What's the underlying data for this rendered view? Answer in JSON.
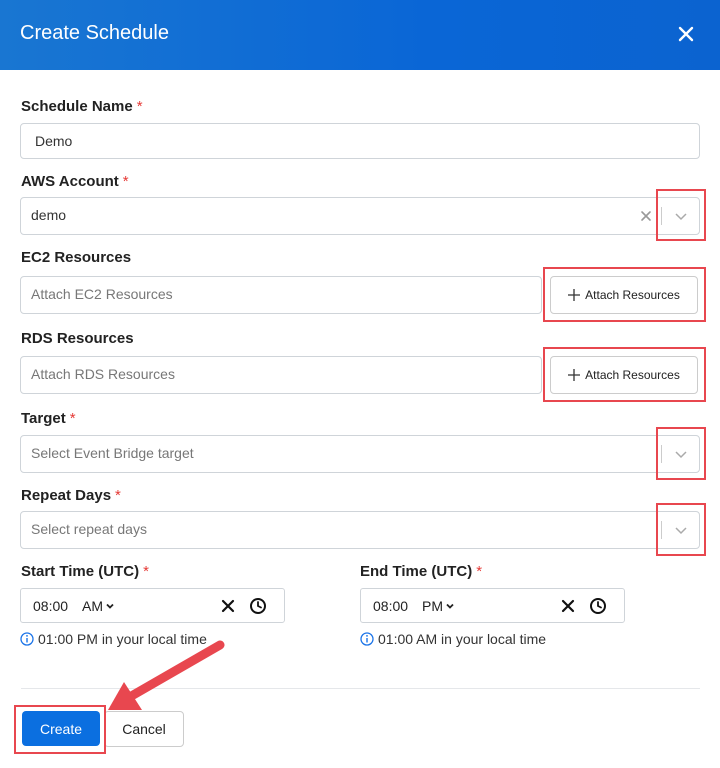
{
  "dialog": {
    "title": "Create Schedule"
  },
  "schedule_name": {
    "label": "Schedule Name",
    "required": "*",
    "value": "Demo"
  },
  "aws_account": {
    "label": "AWS Account",
    "required": "*",
    "value": "demo"
  },
  "ec2": {
    "label": "EC2 Resources",
    "placeholder": "Attach EC2 Resources",
    "button": "Attach Resources"
  },
  "rds": {
    "label": "RDS Resources",
    "placeholder": "Attach RDS Resources",
    "button": "Attach Resources"
  },
  "target": {
    "label": "Target",
    "required": "*",
    "placeholder": "Select Event Bridge target"
  },
  "repeat_days": {
    "label": "Repeat Days",
    "required": "*",
    "placeholder": "Select repeat days"
  },
  "start_time": {
    "label": "Start Time (UTC)",
    "required": "*",
    "time": "08:00",
    "ampm": "AM",
    "local_hint": "01:00 PM in your local time"
  },
  "end_time": {
    "label": "End Time (UTC)",
    "required": "*",
    "time": "08:00",
    "ampm": "PM",
    "local_hint": "01:00 AM in your local time"
  },
  "footer": {
    "create": "Create",
    "cancel": "Cancel"
  },
  "colors": {
    "header": "#0b63d0",
    "primary": "#0b6fe0",
    "highlight": "#e8474f",
    "required": "#e53935"
  }
}
